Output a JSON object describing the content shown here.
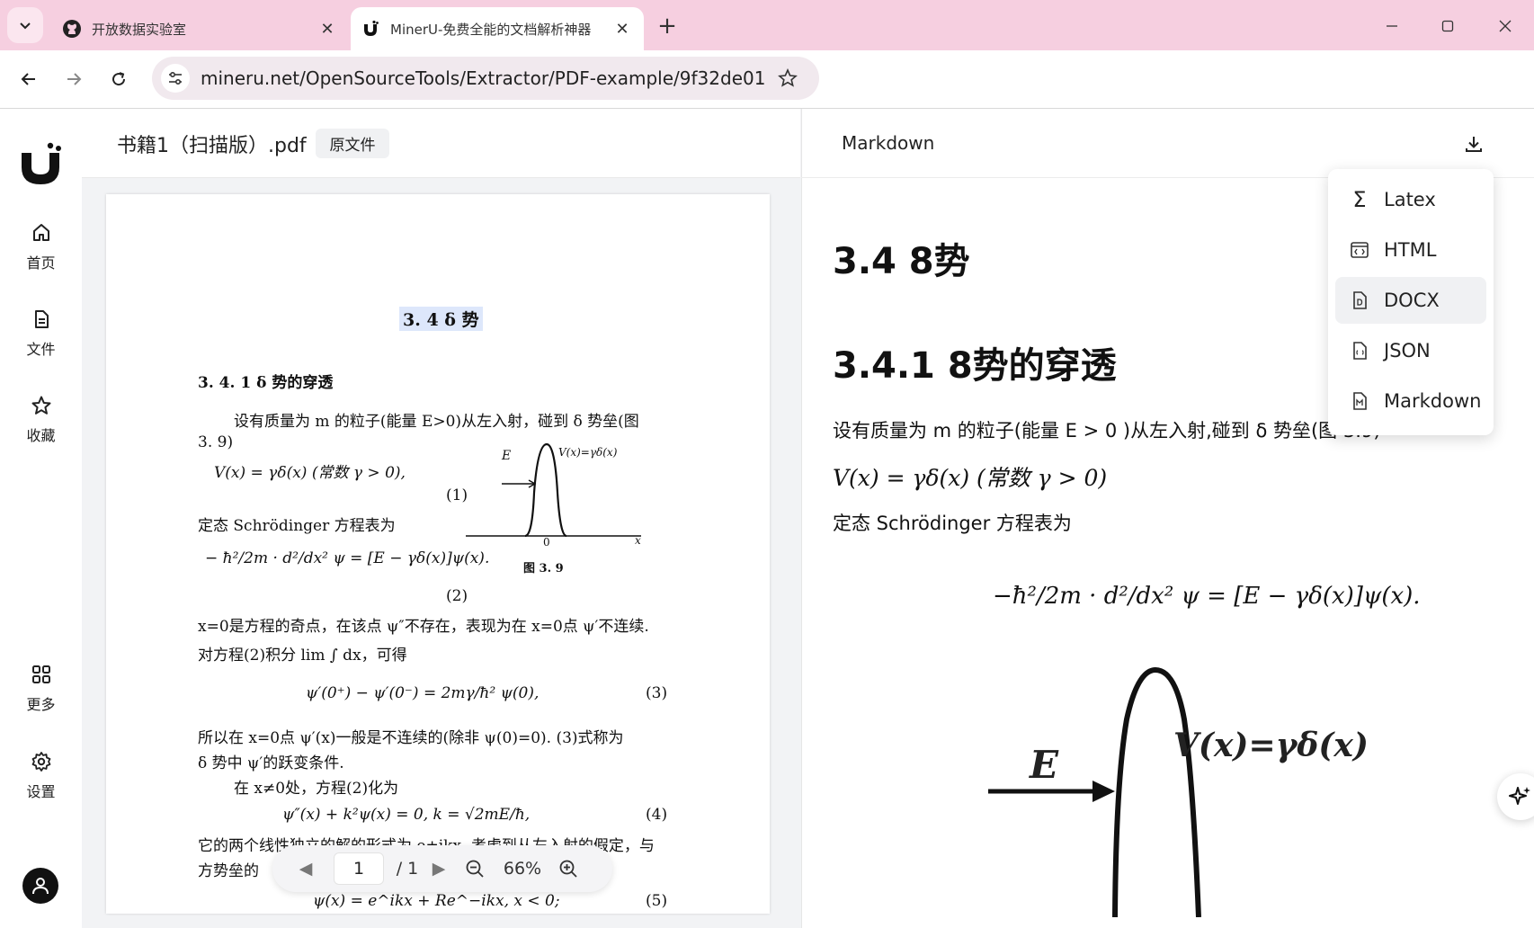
{
  "browser": {
    "tabs": [
      {
        "title": "开放数据实验室",
        "icon": "github-icon",
        "active": false
      },
      {
        "title": "MinerU-免费全能的文档解析神器",
        "icon": "mineru-icon",
        "active": true
      }
    ],
    "url": "mineru.net/OpenSourceTools/Extractor/PDF-example/9f32de01-..."
  },
  "sidebar": {
    "items": [
      {
        "label": "首页",
        "icon": "home-icon"
      },
      {
        "label": "文件",
        "icon": "file-icon"
      },
      {
        "label": "收藏",
        "icon": "star-icon"
      },
      {
        "label": "更多",
        "icon": "grid-icon"
      },
      {
        "label": "设置",
        "icon": "gear-icon"
      }
    ]
  },
  "left_pane": {
    "file_name": "书籍1（扫描版）.pdf",
    "original_tag": "原文件",
    "page": {
      "title": "3. 4  δ 势",
      "subtitle": "3. 4. 1  δ 势的穿透",
      "lines": [
        "设有质量为 m 的粒子(能量 E>0)从左入射，碰到 δ 势垒(图",
        "3. 9)",
        "V(x) = γδ(x)  (常数 γ > 0),",
        "(1)",
        "定态 Schrödinger 方程表为",
        "− ħ²/2m · d²/dx² ψ = [E − γδ(x)]ψ(x).",
        "(2)",
        "x=0是方程的奇点，在该点 ψ″不存在，表现为在 x=0点 ψ′不连续.",
        "对方程(2)积分 lim ∫ dx，可得",
        "ψ′(0⁺) − ψ′(0⁻) = 2mγ/ħ² ψ(0),",
        "(3)",
        "所以在 x=0点 ψ′(x)一般是不连续的(除非 ψ(0)=0). (3)式称为",
        "δ 势中 ψ′的跃变条件.",
        "在 x≠0处，方程(2)化为",
        "ψ″(x) + k²ψ(x) = 0,   k = √2mE/ħ,",
        "(4)",
        "它的两个线性独立的解的形式为 e±ikx. 考虑到从左入射的假定，与",
        "方势垒的",
        "ψ(x) = e^ikx + Re^−ikx,  x < 0;",
        "(5)"
      ],
      "figure": {
        "E_label": "E",
        "V_label": "V(x)=γδ(x)",
        "origin": "0",
        "x_axis": "x",
        "caption": "图  3. 9"
      }
    },
    "controls": {
      "page": "1",
      "total": "/ 1",
      "zoom": "66%"
    }
  },
  "right_pane": {
    "tab_label": "Markdown",
    "h1": "3.4 8势",
    "h2": "3.4.1 8势的穿透",
    "p1": "设有质量为 m 的粒子(能量 E > 0 )从左入射,碰到 δ 势垒(图 3.9)",
    "p2": "V(x) = γδ(x) (常数 γ > 0)",
    "p3": "定态 Schrödinger 方程表为",
    "equation": "−ħ²/2m · d²/dx² ψ = [E − γδ(x)]ψ(x).",
    "figure": {
      "E_label": "E",
      "V_label": "V(x)=γδ(x)"
    }
  },
  "export_menu": {
    "items": [
      {
        "label": "Latex",
        "icon": "sigma-icon"
      },
      {
        "label": "HTML",
        "icon": "html-icon"
      },
      {
        "label": "DOCX",
        "icon": "docx-icon"
      },
      {
        "label": "JSON",
        "icon": "json-icon"
      },
      {
        "label": "Markdown",
        "icon": "markdown-icon"
      }
    ],
    "active": "DOCX"
  }
}
